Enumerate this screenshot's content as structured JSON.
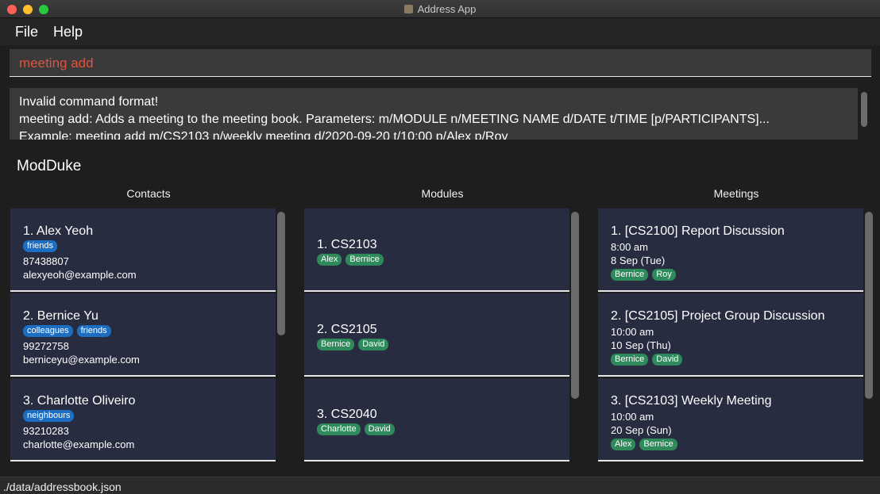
{
  "window": {
    "title": "Address App"
  },
  "menu": {
    "file": "File",
    "help": "Help"
  },
  "command": {
    "value": "meeting add"
  },
  "result": {
    "lines": [
      "Invalid command format!",
      "meeting add: Adds a meeting to the meeting book. Parameters: m/MODULE n/MEETING NAME d/DATE t/TIME [p/PARTICIPANTS]...",
      "Example: meeting add m/CS2103 n/weekly meeting d/2020-09-20 t/10:00 p/Alex p/Roy"
    ]
  },
  "app_title": "ModDuke",
  "columns": {
    "contacts": "Contacts",
    "modules": "Modules",
    "meetings": "Meetings"
  },
  "contacts": [
    {
      "title": "1.  Alex Yeoh",
      "tags": [
        "friends"
      ],
      "phone": "87438807",
      "email": "alexyeoh@example.com"
    },
    {
      "title": "2.  Bernice Yu",
      "tags": [
        "colleagues",
        "friends"
      ],
      "phone": "99272758",
      "email": "berniceyu@example.com"
    },
    {
      "title": "3.  Charlotte Oliveiro",
      "tags": [
        "neighbours"
      ],
      "phone": "93210283",
      "email": "charlotte@example.com"
    }
  ],
  "modules": [
    {
      "title": "1.  CS2103",
      "tags": [
        "Alex",
        "Bernice"
      ]
    },
    {
      "title": "2.  CS2105",
      "tags": [
        "Bernice",
        "David"
      ]
    },
    {
      "title": "3.  CS2040",
      "tags": [
        "Charlotte",
        "David"
      ]
    }
  ],
  "meetings": [
    {
      "title": "1.  [CS2100] Report Discussion",
      "time": "8:00 am",
      "date": "8 Sep (Tue)",
      "tags": [
        "Bernice",
        "Roy"
      ]
    },
    {
      "title": "2.  [CS2105] Project Group Discussion",
      "time": "10:00 am",
      "date": "10 Sep (Thu)",
      "tags": [
        "Bernice",
        "David"
      ]
    },
    {
      "title": "3.  [CS2103] Weekly Meeting",
      "time": "10:00 am",
      "date": "20 Sep (Sun)",
      "tags": [
        "Alex",
        "Bernice"
      ]
    }
  ],
  "status": {
    "path": "./data/addressbook.json"
  },
  "colors": {
    "card_bg": "#272c40",
    "contact_tag": "#1c6ec2",
    "participant_tag": "#2f8a5b",
    "command_text": "#e0533f"
  }
}
